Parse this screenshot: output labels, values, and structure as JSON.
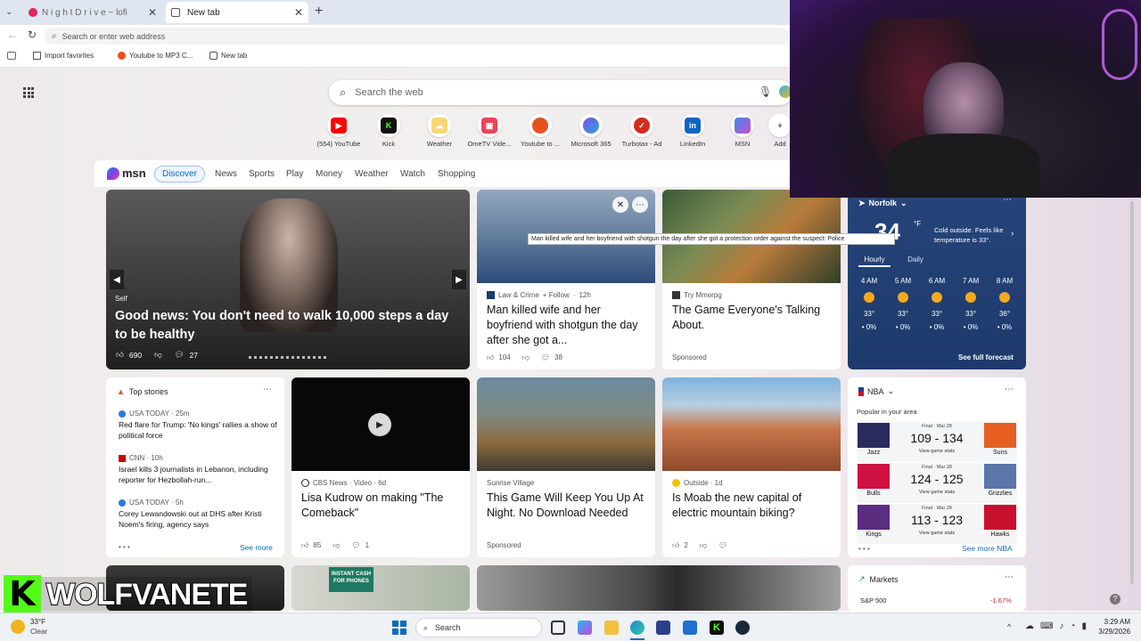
{
  "browser": {
    "tabs": [
      {
        "title": "N i g h t  D r i v e ~ lofi"
      },
      {
        "title": "New tab"
      }
    ],
    "address_placeholder": "Search or enter web address",
    "favorites": [
      "Import favorites",
      "Youtube to MP3 C...",
      "New tab"
    ]
  },
  "newtab": {
    "search_placeholder": "Search the web",
    "quick_links": [
      "(554) YouTube",
      "Kick",
      "Weather",
      "OmeTV Vide...",
      "Youtube to ...",
      "Microsoft 365",
      "Turbotax - Ad",
      "LinkedIn",
      "MSN",
      "Add"
    ]
  },
  "msn": {
    "brand": "msn",
    "nav": [
      "Discover",
      "News",
      "Sports",
      "Play",
      "Money",
      "Weather",
      "Watch",
      "Shopping"
    ],
    "hero": {
      "source": "Self",
      "headline": "Good news: You don't need to walk 10,000 steps a day to be healthy",
      "likes": "690",
      "comments": "27"
    },
    "tooltip": "Man killed wife and her boyfriend with shotgun the day after she got a protection order against the suspect: Police",
    "card_crime": {
      "source": "Law & Crime",
      "follow": "+ Follow",
      "age": "12h",
      "headline": "Man killed wife and her boyfriend with shotgun the day after she got a...",
      "likes": "104",
      "comments": "38"
    },
    "card_game1": {
      "source": "Try Mmorpg",
      "headline": "The Game Everyone's Talking About.",
      "badge": "Sponsored"
    },
    "weather": {
      "location": "Norfolk",
      "temp": "34",
      "unit": "°F",
      "summary": "Cold outside. Feels like temperature is 33°.",
      "tabs": [
        "Hourly",
        "Daily"
      ],
      "hours": [
        {
          "time": "4 AM",
          "temp": "33°",
          "precip": "0%"
        },
        {
          "time": "5 AM",
          "temp": "33°",
          "precip": "0%"
        },
        {
          "time": "6 AM",
          "temp": "33°",
          "precip": "0%"
        },
        {
          "time": "7 AM",
          "temp": "33°",
          "precip": "0%"
        },
        {
          "time": "8 AM",
          "temp": "36°",
          "precip": "0%"
        }
      ],
      "full_forecast": "See full forecast"
    },
    "top_stories": {
      "title": "Top stories",
      "items": [
        {
          "source": "USA TODAY · 25m",
          "text": "Red flare for Trump: 'No kings' rallies a show of political force"
        },
        {
          "source": "CNN · 10h",
          "text": "Israel kills 3 journalists in Lebanon, including reporter for Hezbollah-run..."
        },
        {
          "source": "USA TODAY · 5h",
          "text": "Corey Lewandowski out at DHS after Kristi Noem's firing, agency says"
        }
      ],
      "see_more": "See more"
    },
    "card_video": {
      "source": "CBS News · Video · 6d",
      "headline": "Lisa Kudrow on making \"The Comeback\"",
      "likes": "85",
      "comments": "1"
    },
    "card_game2": {
      "source": "Sunrise Village",
      "headline": "This Game Will Keep You Up At Night. No Download Needed",
      "badge": "Sponsored"
    },
    "card_moab": {
      "source": "Outside · 1d",
      "headline": "Is Moab the new capital of electric mountain biking?",
      "likes": "2"
    },
    "nba": {
      "title": "NBA",
      "subtitle": "Popular in your area",
      "games": [
        {
          "status": "Final · Mar 28",
          "score": "109 - 134",
          "home": "Jazz",
          "away": "Suns",
          "stats": "View game stats"
        },
        {
          "status": "Final · Mar 28",
          "score": "124 - 125",
          "home": "Bulls",
          "away": "Grizzlies",
          "stats": "View game stats"
        },
        {
          "status": "Final · Mar 28",
          "score": "113 - 123",
          "home": "Kings",
          "away": "Hawks",
          "stats": "View game stats"
        }
      ],
      "see_more": "See more NBA"
    },
    "markets": {
      "title": "Markets",
      "index": "S&P 500",
      "change": "-1.67%"
    },
    "instant_cash": "INSTANT CASH FOR PHONES"
  },
  "overlay": {
    "streamer": "WOLFVANETE"
  },
  "taskbar": {
    "weather_temp": "33°F",
    "weather_desc": "Clear",
    "search": "Search",
    "time": "3:29 AM",
    "date": "3/29/2026"
  },
  "colors": {
    "accent": "#0f6cbd",
    "kick_green": "#53fc18"
  }
}
